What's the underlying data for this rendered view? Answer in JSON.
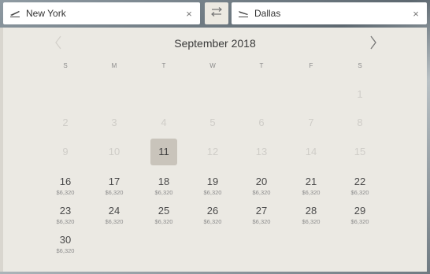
{
  "from": {
    "value": "New York",
    "icon": "plane-takeoff-icon",
    "clear": "×"
  },
  "to": {
    "value": "Dallas",
    "icon": "plane-landing-icon",
    "clear": "×"
  },
  "swap": {
    "icon": "swap-arrows-icon"
  },
  "calendar": {
    "title": "September 2018",
    "prev_icon": "chevron-left-icon",
    "next_icon": "chevron-right-icon",
    "weekdays": [
      "S",
      "M",
      "T",
      "W",
      "T",
      "F",
      "S"
    ],
    "weeks": [
      [
        null,
        null,
        null,
        null,
        null,
        null,
        {
          "d": "1",
          "state": "disabled"
        }
      ],
      [
        {
          "d": "2",
          "state": "disabled"
        },
        {
          "d": "3",
          "state": "disabled"
        },
        {
          "d": "4",
          "state": "disabled"
        },
        {
          "d": "5",
          "state": "disabled"
        },
        {
          "d": "6",
          "state": "disabled"
        },
        {
          "d": "7",
          "state": "disabled"
        },
        {
          "d": "8",
          "state": "disabled"
        }
      ],
      [
        {
          "d": "9",
          "state": "disabled"
        },
        {
          "d": "10",
          "state": "disabled"
        },
        {
          "d": "11",
          "state": "selected"
        },
        {
          "d": "12",
          "state": "disabled"
        },
        {
          "d": "13",
          "state": "disabled"
        },
        {
          "d": "14",
          "state": "disabled"
        },
        {
          "d": "15",
          "state": "disabled"
        }
      ],
      [
        {
          "d": "16",
          "state": "enabled",
          "p": "$6,320"
        },
        {
          "d": "17",
          "state": "enabled",
          "p": "$6,320"
        },
        {
          "d": "18",
          "state": "enabled",
          "p": "$6,320"
        },
        {
          "d": "19",
          "state": "enabled",
          "p": "$6,320"
        },
        {
          "d": "20",
          "state": "enabled",
          "p": "$6,320"
        },
        {
          "d": "21",
          "state": "enabled",
          "p": "$6,320"
        },
        {
          "d": "22",
          "state": "enabled",
          "p": "$6,320"
        }
      ],
      [
        {
          "d": "23",
          "state": "enabled",
          "p": "$6,320"
        },
        {
          "d": "24",
          "state": "enabled",
          "p": "$6,320"
        },
        {
          "d": "25",
          "state": "enabled",
          "p": "$6,320"
        },
        {
          "d": "26",
          "state": "enabled",
          "p": "$6,320"
        },
        {
          "d": "27",
          "state": "enabled",
          "p": "$6,320"
        },
        {
          "d": "28",
          "state": "enabled",
          "p": "$6,320"
        },
        {
          "d": "29",
          "state": "enabled",
          "p": "$6,320"
        }
      ],
      [
        {
          "d": "30",
          "state": "enabled",
          "p": "$6,320"
        },
        null,
        null,
        null,
        null,
        null,
        null
      ]
    ]
  },
  "colors": {
    "panel": "#ebe9e3",
    "selected": "#c9c4bb",
    "disabled_text": "#cfcdc8"
  }
}
